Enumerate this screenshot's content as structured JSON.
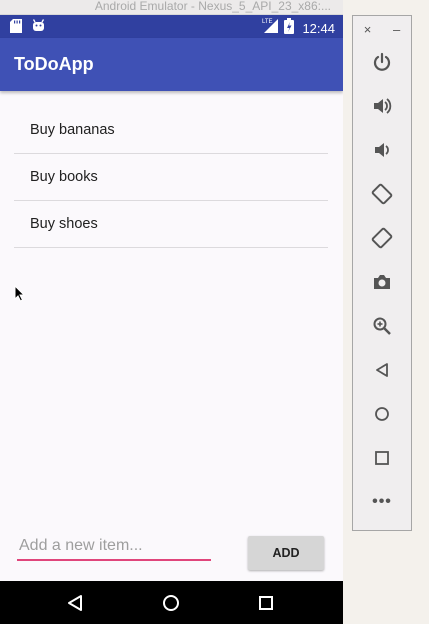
{
  "window": {
    "title": "Android Emulator - Nexus_5_API_23_x86:..."
  },
  "status_bar": {
    "time": "12:44",
    "network": "LTE",
    "icons": [
      "sd-card-icon",
      "android-icon",
      "signal-icon",
      "battery-icon"
    ]
  },
  "app": {
    "title": "ToDoApp"
  },
  "todo_items": [
    "Buy bananas",
    "Buy books",
    "Buy shoes"
  ],
  "input": {
    "value": "",
    "placeholder": "Add a new item...",
    "accent": "#e0457b"
  },
  "add_button": {
    "label": "ADD"
  },
  "navigation": [
    "back-icon",
    "home-icon",
    "recents-icon"
  ],
  "toolbar": {
    "close": "×",
    "minimize": "–",
    "buttons": [
      "power-icon",
      "volume-up-icon",
      "volume-down-icon",
      "rotate-left-icon",
      "rotate-right-icon",
      "camera-icon",
      "zoom-icon",
      "back-icon",
      "home-icon",
      "overview-icon"
    ],
    "more": "•••"
  },
  "colors": {
    "primary": "#3f51b5",
    "primary_dark": "#3040a0",
    "accent": "#e0457b",
    "background": "#fbf9fc"
  }
}
